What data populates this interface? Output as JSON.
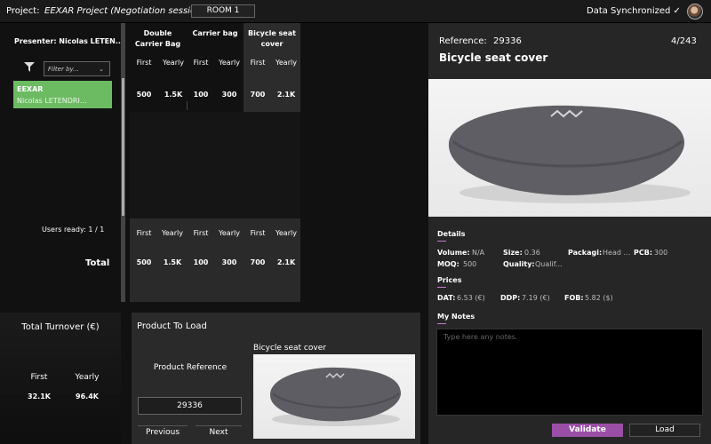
{
  "topbar": {
    "project_label": "Project:",
    "project_name": "EEXAR Project (Negotiation session)",
    "room": "ROOM 1",
    "sync_status": "Data Synchronized ✓"
  },
  "left": {
    "presenter": "Presenter: Nicolas LETEN...",
    "filter_placeholder": "Filter by...",
    "user": {
      "name": "EEXAR",
      "subtitle": "Nicolas LETENDRI..."
    },
    "users_ready": "Users ready:  1  /  1",
    "total_label": "Total"
  },
  "products": [
    {
      "name": "Double Carrier Bag",
      "first": "500",
      "yearly": "1.5K",
      "total_first": "500",
      "total_yearly": "1.5K"
    },
    {
      "name": "Carrier bag",
      "first": "100",
      "yearly": "300",
      "total_first": "100",
      "total_yearly": "300"
    },
    {
      "name": "Bicycle seat cover",
      "first": "700",
      "yearly": "2.1K",
      "total_first": "700",
      "total_yearly": "2.1K"
    }
  ],
  "col_labels": {
    "first": "First",
    "yearly": "Yearly"
  },
  "turnover": {
    "title": "Total Turnover (€)",
    "first_label": "First",
    "yearly_label": "Yearly",
    "first_value": "32.1K",
    "yearly_value": "96.4K"
  },
  "to_load": {
    "title": "Product To Load",
    "ref_label": "Product Reference",
    "ref_value": "29336",
    "previous": "Previous",
    "next": "Next",
    "preview_name": "Bicycle seat cover"
  },
  "detail": {
    "reference_label": "Reference:",
    "reference_value": "29336",
    "counter": "4/243",
    "title": "Bicycle seat cover",
    "details_header": "Details",
    "volume_label": "Volume:",
    "volume_value": "N/A",
    "size_label": "Size:",
    "size_value": "0.36",
    "packaging_label": "Packagi:",
    "packaging_value": "Head c...",
    "pcb_label": "PCB:",
    "pcb_value": "300",
    "moq_label": "MOQ:",
    "moq_value": "500",
    "quality_label": "Quality:",
    "quality_value": "Qualif...",
    "prices_header": "Prices",
    "dat_label": "DAT:",
    "dat_value": "6.53 (€)",
    "ddp_label": "DDP:",
    "ddp_value": "7.19 (€)",
    "fob_label": "FOB:",
    "fob_value": "5.82 ($)",
    "notes_header": "My Notes",
    "notes_placeholder": "Type here any notes.",
    "validate": "Validate",
    "load": "Load"
  },
  "colors": {
    "accent": "#9a4fa6",
    "user_card": "#6cbb63",
    "panel": "#262626"
  }
}
